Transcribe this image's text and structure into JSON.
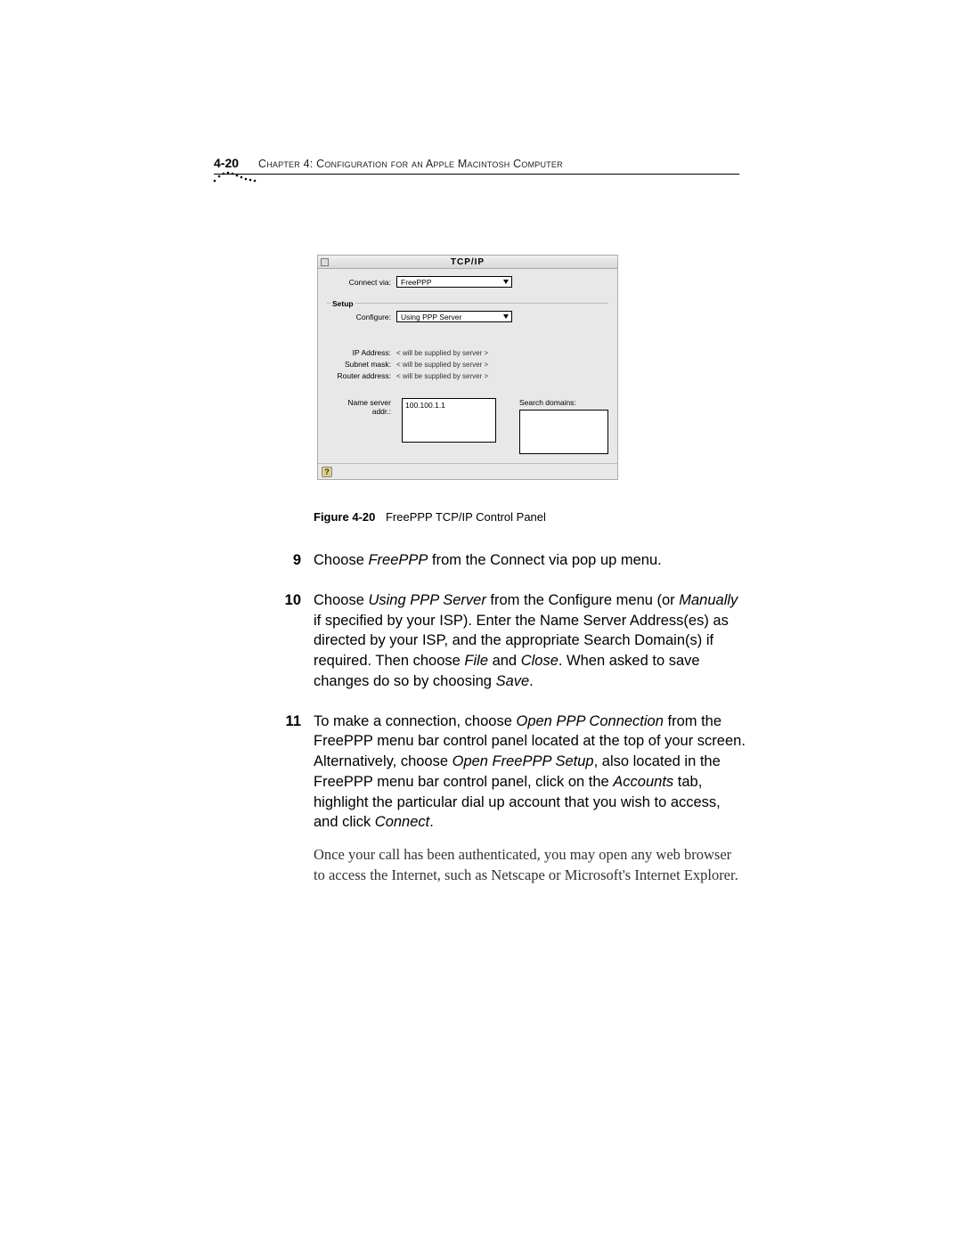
{
  "header": {
    "page_number": "4-20",
    "chapter": "Chapter 4: Configuration for an Apple Macintosh Computer"
  },
  "panel": {
    "title": "TCP/IP",
    "connect_via_label": "Connect via:",
    "connect_via_value": "FreePPP",
    "setup_label": "Setup",
    "configure_label": "Configure:",
    "configure_value": "Using PPP Server",
    "ip_label": "IP Address:",
    "ip_value": "< will be supplied by server >",
    "subnet_label": "Subnet mask:",
    "subnet_value": "< will be supplied by server >",
    "router_label": "Router address:",
    "router_value": "< will be supplied by server >",
    "ns_label": "Name server addr.:",
    "ns_value": "100.100.1.1",
    "search_label": "Search domains:",
    "help_glyph": "?"
  },
  "figure": {
    "label": "Figure 4-20",
    "caption": "FreePPP TCP/IP Control Panel"
  },
  "steps": [
    {
      "num": "9",
      "paras": [
        {
          "text": "Choose <em>FreePPP</em> from the Connect via pop up menu.",
          "trail": false
        }
      ]
    },
    {
      "num": "10",
      "paras": [
        {
          "text": "Choose <em>Using PPP Server</em> from the Configure menu (or <em>Manually</em> if specified by your ISP). Enter the Name Server Address(es) as directed by your ISP, and the appropriate Search Domain(s) if required. Then choose <em>File</em> and <em>Close</em>. When asked to save changes do so by choosing <em>Save</em>.",
          "trail": false
        }
      ]
    },
    {
      "num": "11",
      "paras": [
        {
          "text": "To make a connection, choose <em>Open PPP Connection</em> from the FreePPP menu bar control panel located at the top of your screen. Alternatively, choose <em>Open FreePPP Setup</em>, also located in the FreePPP menu bar control panel, click on the <em>Accounts</em> tab, highlight the particular dial up account that you wish to access, and click <em>Connect</em>.",
          "trail": false
        },
        {
          "text": "Once your call has been authenticated, you may open any web browser to access the Internet, such as Netscape or Microsoft's Internet Explorer.",
          "trail": true
        }
      ]
    }
  ]
}
